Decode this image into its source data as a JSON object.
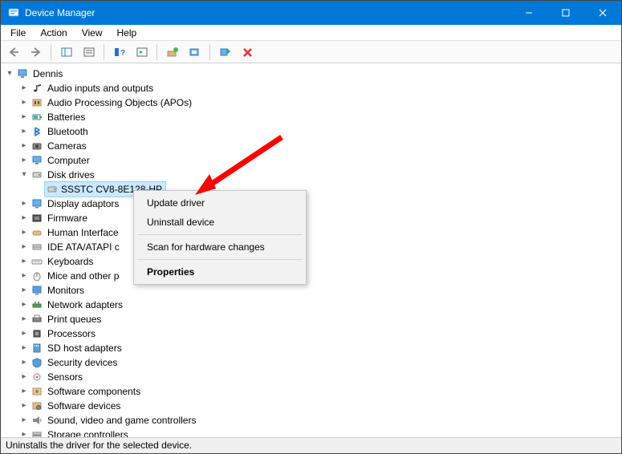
{
  "title": "Device Manager",
  "menu": {
    "file": "File",
    "action": "Action",
    "view": "View",
    "help": "Help"
  },
  "root": "Dennis",
  "categories": [
    "Audio inputs and outputs",
    "Audio Processing Objects (APOs)",
    "Batteries",
    "Bluetooth",
    "Cameras",
    "Computer",
    "Disk drives",
    "Display adaptors",
    "Firmware",
    "Human Interface",
    "IDE ATA/ATAPI c",
    "Keyboards",
    "Mice and other p",
    "Monitors",
    "Network adapters",
    "Print queues",
    "Processors",
    "SD host adapters",
    "Security devices",
    "Sensors",
    "Software components",
    "Software devices",
    "Sound, video and game controllers",
    "Storage controllers"
  ],
  "selected_device": "SSSTC CV8-8E128-HP",
  "context_menu": {
    "update": "Update driver",
    "uninstall": "Uninstall device",
    "scan": "Scan for hardware changes",
    "properties": "Properties"
  },
  "status": "Uninstalls the driver for the selected device."
}
